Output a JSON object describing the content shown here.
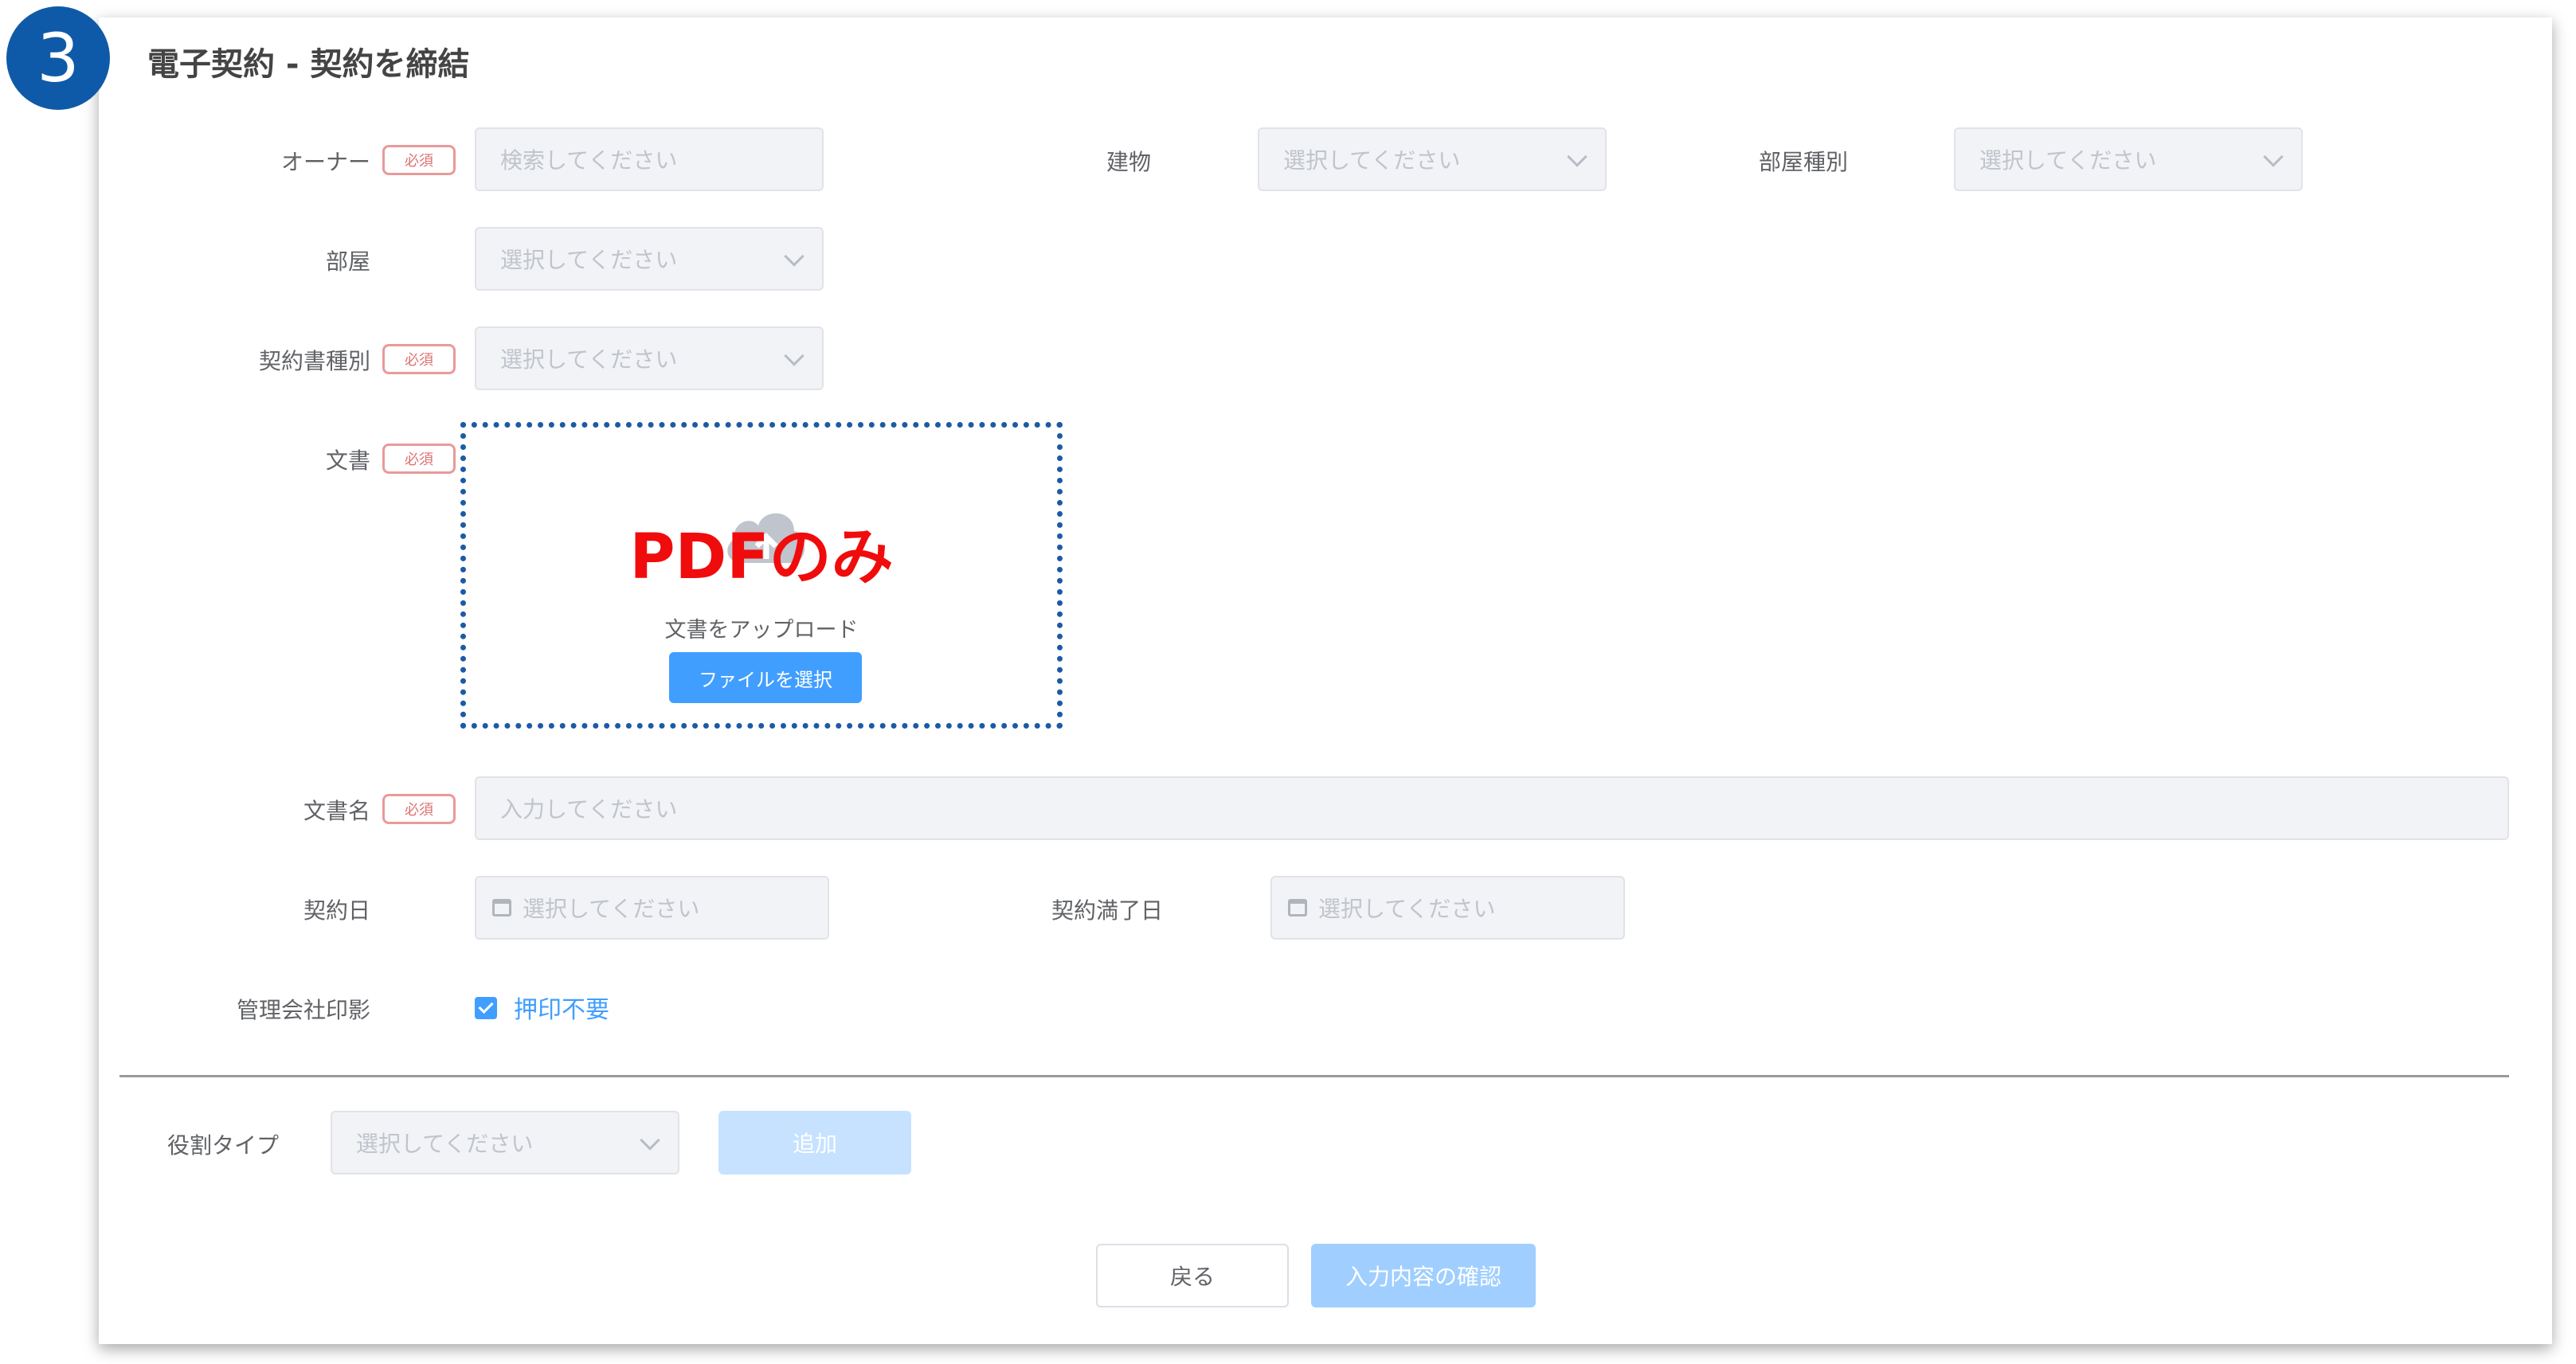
{
  "step_number": "3",
  "page_title": "電子契約 - 契約を締結",
  "required_badge": "必須",
  "fields": {
    "owner": {
      "label": "オーナー",
      "placeholder": "検索してください"
    },
    "building": {
      "label": "建物",
      "placeholder": "選択してください"
    },
    "room_type": {
      "label": "部屋種別",
      "placeholder": "選択してください"
    },
    "room": {
      "label": "部屋",
      "placeholder": "選択してください"
    },
    "contract_type": {
      "label": "契約書種別",
      "placeholder": "選択してください"
    },
    "document": {
      "label": "文書"
    },
    "document_name": {
      "label": "文書名",
      "placeholder": "入力してください"
    },
    "contract_date": {
      "label": "契約日",
      "placeholder": "選択してください"
    },
    "contract_end_date": {
      "label": "契約満了日",
      "placeholder": "選択してください"
    },
    "company_seal": {
      "label": "管理会社印影",
      "checkbox_label": "押印不要",
      "checked": true
    },
    "role_type": {
      "label": "役割タイプ",
      "placeholder": "選択してください"
    }
  },
  "upload": {
    "annotation": "PDFのみ",
    "text": "文書をアップロード",
    "button": "ファイルを選択"
  },
  "buttons": {
    "add": "追加",
    "back": "戻る",
    "confirm": "入力内容の確認"
  },
  "colors": {
    "primary": "#409eff",
    "badge": "#0f5aa8",
    "annotation": "#f00c0c",
    "required_border": "#e99a9a"
  }
}
